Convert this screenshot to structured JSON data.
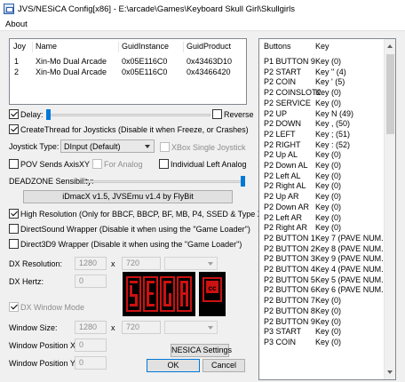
{
  "window": {
    "title": "JVS/NESiCA Config[x86] - E:\\arcade\\Games\\Keyboard Skull Girl\\Skullgirls"
  },
  "menu": {
    "about": "About"
  },
  "joysticks": {
    "headers": [
      "Joy",
      "Name",
      "GuidInstance",
      "GuidProduct"
    ],
    "rows": [
      [
        "1",
        "Xin-Mo Dual Arcade",
        "0x05E116C0",
        "0x43463D10"
      ],
      [
        "2",
        "Xin-Mo Dual Arcade",
        "0x05E116C0",
        "0x43466420"
      ]
    ]
  },
  "options": {
    "delay_label": "Delay:",
    "delay_checked": true,
    "delay_level": 0,
    "reverse_label": "Reverse",
    "reverse_checked": false,
    "create_thread_label": "CreateThread for Joysticks (Disable it when Freeze, or Crashes)",
    "create_thread_checked": true,
    "joystick_type_label": "Joystick Type:",
    "joystick_type_value": "DInput (Default)",
    "xbox_single_label": "XBox Single Joystick",
    "pov_label": "POV Sends AxisXY",
    "for_analog_label": "For Analog",
    "individual_left_analog_label": "Individual Left Analog",
    "deadzone_label": "DEADZONE Sensibility:",
    "deadzone_level": 0.97,
    "version_text": "iDmacX v1.5, JVSEmu v1.4 by FlyBit",
    "high_res_label": "High Resolution (Only for BBCF, BBCP, BF, MB, P4, SSED & Type X)",
    "high_res_checked": true,
    "directsound_label": "DirectSound Wrapper (Disable it when using the \"Game Loader\")",
    "direct3d_label": "Direct3D9 Wrapper (Disable it when using the \"Game Loader\")"
  },
  "display": {
    "dx_resolution_label": "DX Resolution:",
    "res_width": "1280",
    "res_x": "x",
    "res_height": "720",
    "dx_hertz_label": "DX Hertz:",
    "hertz_value": "0",
    "dx_window_mode_label": "DX Window Mode",
    "window_size_label": "Window Size:",
    "win_width": "1280",
    "win_x": "x",
    "win_height": "720",
    "window_pos_x_label": "Window Position X:",
    "pos_x_value": "0",
    "window_pos_y_label": "Window Position Y:",
    "pos_y_value": "0"
  },
  "buttons": {
    "nesica_settings": "NESICA Settings",
    "ok": "OK",
    "cancel": "Cancel"
  },
  "keys": {
    "headers": [
      "Buttons",
      "Key"
    ],
    "rows": [
      [
        "P1 BUTTON 9",
        "Key  (0)"
      ],
      [
        "P2 START",
        "Key \" (4)"
      ],
      [
        "P2 COIN",
        "Key ' (5)"
      ],
      [
        "P2 COINSLOT2",
        "Key  (0)"
      ],
      [
        "P2 SERVICE",
        "Key  (0)"
      ],
      [
        "P2 UP",
        "Key N (49)"
      ],
      [
        "P2 DOWN",
        "Key , (50)"
      ],
      [
        "P2 LEFT",
        "Key ; (51)"
      ],
      [
        "P2 RIGHT",
        "Key : (52)"
      ],
      [
        "P2 Up AL",
        "Key  (0)"
      ],
      [
        "P2 Down AL",
        "Key  (0)"
      ],
      [
        "P2 Left AL",
        "Key  (0)"
      ],
      [
        "P2 Right AL",
        "Key  (0)"
      ],
      [
        "P2 Up AR",
        "Key  (0)"
      ],
      [
        "P2 Down AR",
        "Key  (0)"
      ],
      [
        "P2 Left AR",
        "Key  (0)"
      ],
      [
        "P2 Right AR",
        "Key  (0)"
      ],
      [
        "P2 BUTTON 1",
        "Key 7 (PAVE NUM..."
      ],
      [
        "P2 BUTTON 2",
        "Key 8 (PAVE NUM..."
      ],
      [
        "P2 BUTTON 3",
        "Key 9 (PAVE NUM..."
      ],
      [
        "P2 BUTTON 4",
        "Key 4 (PAVE NUM..."
      ],
      [
        "P2 BUTTON 5",
        "Key 5 (PAVE NUM..."
      ],
      [
        "P2 BUTTON 6",
        "Key 6 (PAVE NUM..."
      ],
      [
        "P2 BUTTON 7",
        "Key  (0)"
      ],
      [
        "P2 BUTTON 8",
        "Key  (0)"
      ],
      [
        "P2 BUTTON 9",
        "Key  (0)"
      ],
      [
        "P3 START",
        "Key  (0)"
      ],
      [
        "P3 COIN",
        "Key  (0)"
      ]
    ]
  },
  "colors": {
    "logo_bg": "#000000",
    "logo_red": "#cc1111",
    "accent": "#0078d7"
  },
  "icons": {
    "app": "app-window-icon",
    "logo_sega": "sega-logo-icon",
    "logo_cc": "cc-logo-icon"
  }
}
